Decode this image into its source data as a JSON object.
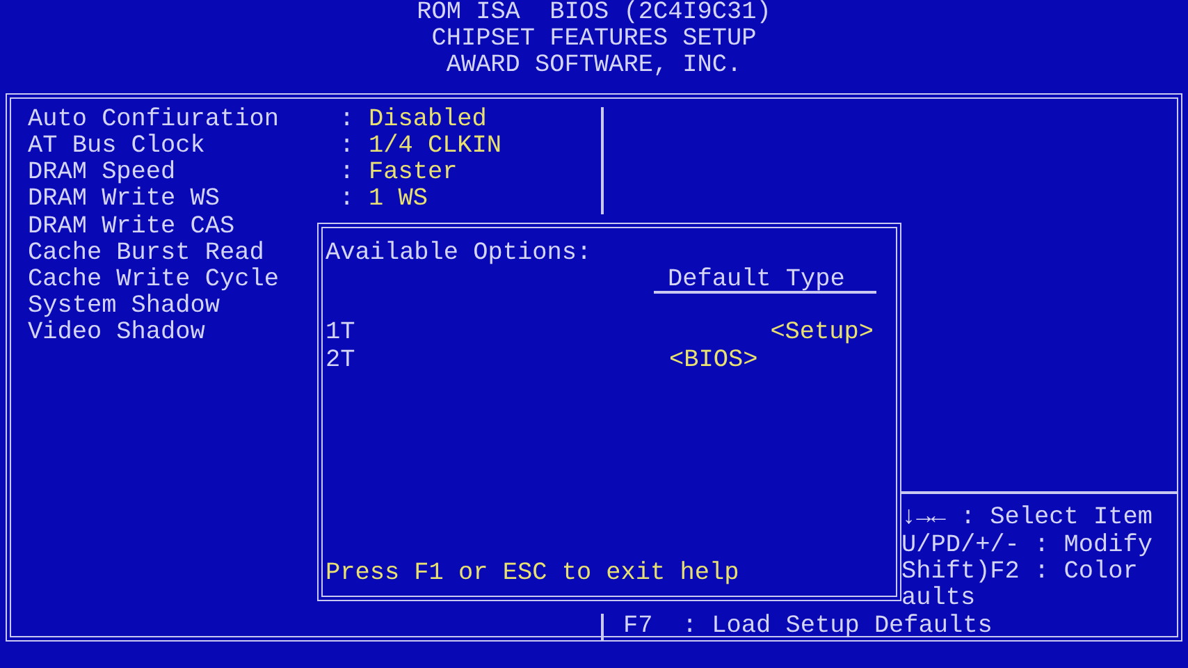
{
  "header": {
    "lines": [
      "ROM ISA  BIOS (2C4I9C31)",
      "CHIPSET FEATURES SETUP",
      "AWARD SOFTWARE, INC."
    ]
  },
  "settings": [
    {
      "label": "Auto Confiuration",
      "separator": ":",
      "value": "Disabled"
    },
    {
      "label": "AT Bus Clock",
      "separator": ":",
      "value": "1/4 CLKIN"
    },
    {
      "label": "DRAM Speed",
      "separator": ":",
      "value": "Faster"
    },
    {
      "label": "DRAM Write WS",
      "separator": ":",
      "value": "1 WS"
    },
    {
      "label": "DRAM Write CAS"
    },
    {
      "label": "Cache Burst Read"
    },
    {
      "label": "Cache Write Cycle"
    },
    {
      "label": "System Shadow"
    },
    {
      "label": "Video Shadow"
    }
  ],
  "help_popup": {
    "title": "Available Options:",
    "column_heading": "Default Type",
    "options": [
      {
        "label": "1T",
        "default": "<Setup>"
      },
      {
        "label": "2T",
        "default": "<BIOS>"
      }
    ],
    "footer": "Press F1 or ESC to exit help"
  },
  "key_help": [
    "↓→← : Select Item",
    "U/PD/+/- : Modify",
    "Shift)F2 : Color",
    "aults"
  ],
  "bottom_key": "F7  : Load Setup Defaults"
}
